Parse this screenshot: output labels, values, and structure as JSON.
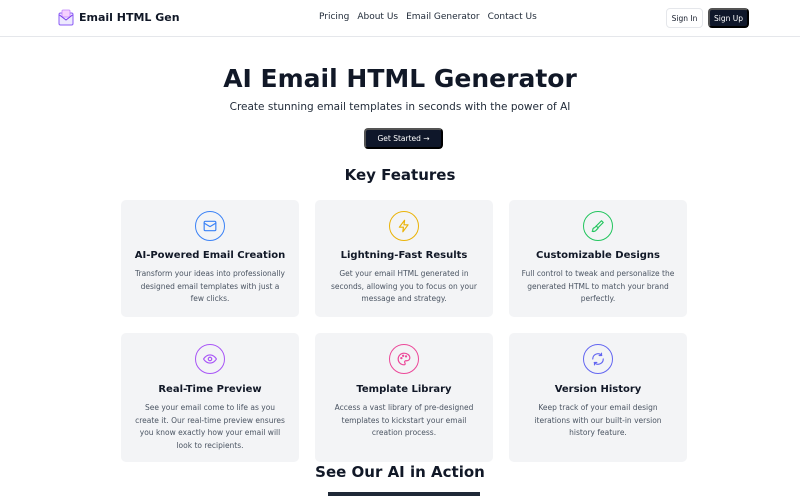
{
  "brand": {
    "name": "Email HTML Gen",
    "icon": "envelope-logo-icon"
  },
  "nav": {
    "links": [
      "Pricing",
      "About Us",
      "Email Generator",
      "Contact Us"
    ],
    "signin_label": "Sign In",
    "signup_label": "Sign Up"
  },
  "hero": {
    "title": "AI Email HTML Generator",
    "subtitle": "Create stunning email templates in seconds with the power of AI",
    "cta_label": "Get Started →"
  },
  "features": {
    "title": "Key Features",
    "cards": [
      {
        "title": "AI-Powered Email Creation",
        "desc": "Transform your ideas into professionally designed email templates with just a few clicks.",
        "icon": "mail-icon",
        "color": "#3b82f6"
      },
      {
        "title": "Lightning-Fast Results",
        "desc": "Get your email HTML generated in seconds, allowing you to focus on your message and strategy.",
        "icon": "lightning-icon",
        "color": "#eab308"
      },
      {
        "title": "Customizable Designs",
        "desc": "Full control to tweak and personalize the generated HTML to match your brand perfectly.",
        "icon": "paintbrush-icon",
        "color": "#22c55e"
      },
      {
        "title": "Real-Time Preview",
        "desc": "See your email come to life as you create it. Our real-time preview ensures you know exactly how your email will look to recipients.",
        "icon": "eye-icon",
        "color": "#a855f7"
      },
      {
        "title": "Template Library",
        "desc": "Access a vast library of pre-designed templates to kickstart your email creation process.",
        "icon": "palette-icon",
        "color": "#ec4899"
      },
      {
        "title": "Version History",
        "desc": "Keep track of your email design iterations with our built-in version history feature.",
        "icon": "refresh-icon",
        "color": "#6366f1"
      }
    ]
  },
  "action": {
    "title": "See Our AI in Action"
  }
}
